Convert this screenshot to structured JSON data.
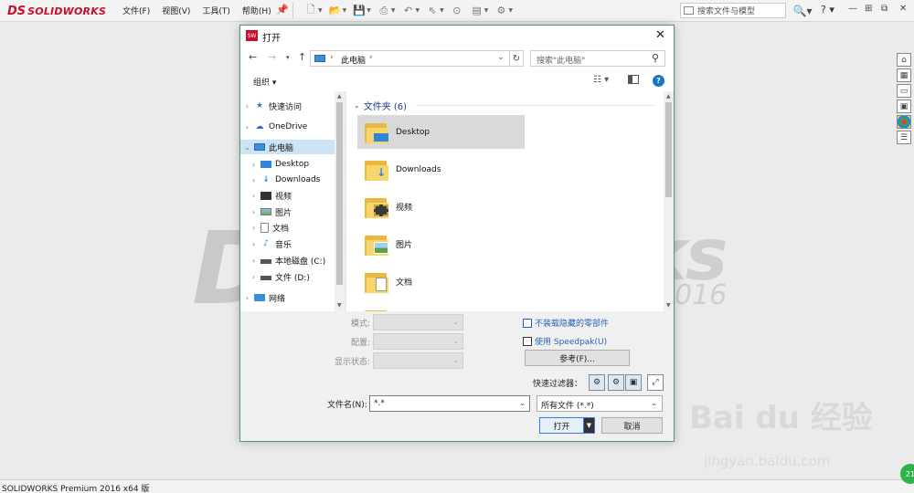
{
  "app": {
    "logo_mark": "DS",
    "logo_text": "SOLIDWORKS",
    "menu": [
      "文件(F)",
      "视图(V)",
      "工具(T)",
      "帮助(H)"
    ],
    "search_placeholder": "搜索文件与模型",
    "status_text": "SOLIDWORKS Premium 2016 x64 版",
    "watermark_left": "D",
    "watermark": "ks",
    "watermark_year": "016",
    "badge": "21"
  },
  "baidu": {
    "logo": "Bai du 经验",
    "url": "jingyan.baidu.com"
  },
  "dialog": {
    "title": "打开",
    "title_icon": "SW",
    "address": "此电脑",
    "search_placeholder": "搜索\"此电脑\"",
    "organize": "组织 ▾",
    "nav_items": [
      {
        "label": "快速访问",
        "icon": "star-icon",
        "level": 0
      },
      {
        "label": "OneDrive",
        "icon": "cloud-icon",
        "level": 0
      },
      {
        "label": "此电脑",
        "icon": "computer-icon",
        "level": 0,
        "selected": true
      },
      {
        "label": "Desktop",
        "icon": "desktop-icon",
        "level": 1
      },
      {
        "label": "Downloads",
        "icon": "download-icon",
        "level": 1
      },
      {
        "label": "视频",
        "icon": "video-icon",
        "level": 1
      },
      {
        "label": "图片",
        "icon": "picture-icon",
        "level": 1
      },
      {
        "label": "文档",
        "icon": "document-icon",
        "level": 1
      },
      {
        "label": "音乐",
        "icon": "music-icon",
        "level": 1
      },
      {
        "label": "本地磁盘 (C:)",
        "icon": "drive-icon",
        "level": 1
      },
      {
        "label": "文件 (D:)",
        "icon": "drive-icon",
        "level": 1
      },
      {
        "label": "网络",
        "icon": "network-icon",
        "level": 0
      }
    ],
    "group_header": "文件夹 (6)",
    "folders": [
      {
        "label": "Desktop",
        "icon": "desktop-icon",
        "selected": true
      },
      {
        "label": "Downloads",
        "icon": "download-icon"
      },
      {
        "label": "视频",
        "icon": "video-icon"
      },
      {
        "label": "图片",
        "icon": "picture-icon"
      },
      {
        "label": "文档",
        "icon": "document-icon"
      }
    ],
    "mode_label": "模式:",
    "config_label": "配置:",
    "display_state_label": "显示状态:",
    "chk_hidden": "不装载隐藏的零部件",
    "chk_speedpak": "使用 Speedpak(U)",
    "browse": "参考(F)...",
    "quick_filter": "快速过滤器：",
    "filename_label": "文件名(N):",
    "filename_value": "*.*",
    "filetype_value": "所有文件 (*.*)",
    "open": "打开",
    "cancel": "取消"
  }
}
